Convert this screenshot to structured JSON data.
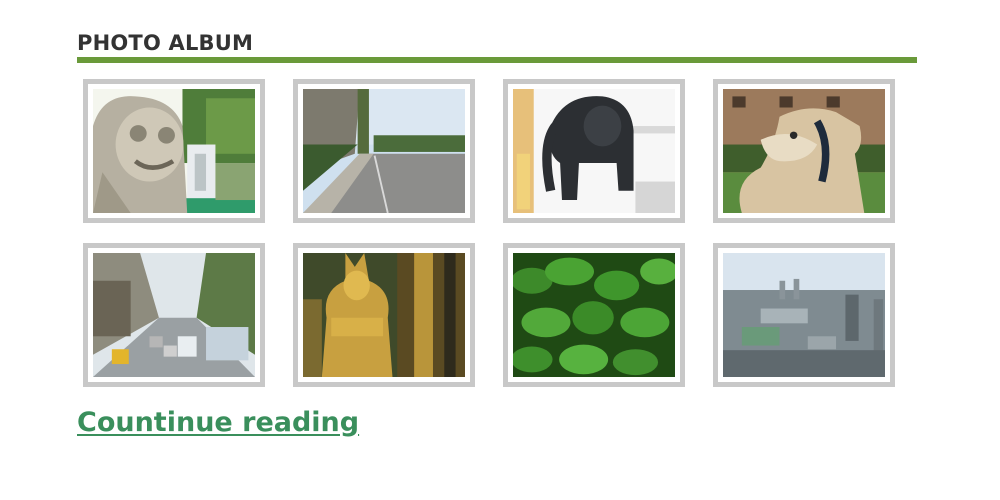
{
  "album": {
    "title": "PHOTO ALBUM",
    "accent_color": "#6a9a3a",
    "photos": [
      {
        "subject": "stone-guardian-statue"
      },
      {
        "subject": "roadside-street"
      },
      {
        "subject": "elephant-statue"
      },
      {
        "subject": "greyhound-dog"
      },
      {
        "subject": "city-traffic-street"
      },
      {
        "subject": "golden-temple-statue"
      },
      {
        "subject": "green-leaves"
      },
      {
        "subject": "city-skyline"
      }
    ]
  },
  "link": {
    "label": "Countinue reading",
    "color": "#3a8f5c"
  }
}
